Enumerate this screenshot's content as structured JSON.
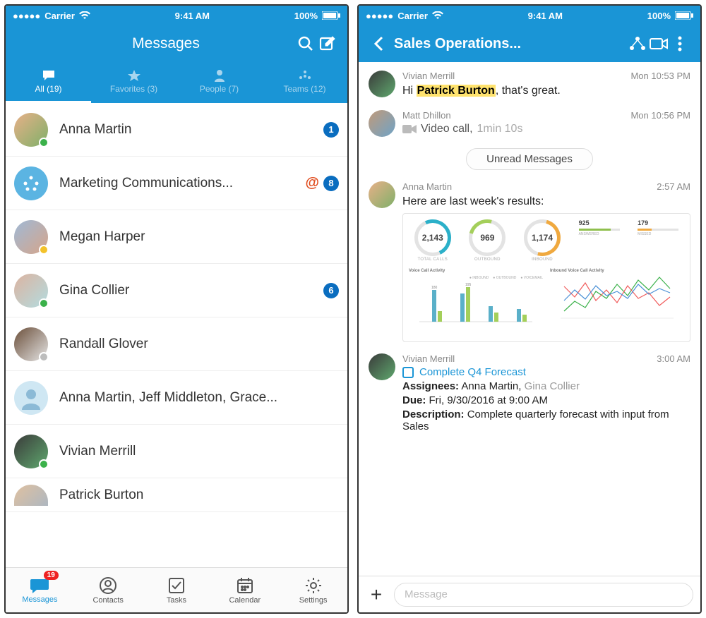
{
  "status": {
    "carrier": "Carrier",
    "time": "9:41 AM",
    "battery": "100%"
  },
  "left": {
    "title": "Messages",
    "tabs": [
      {
        "label": "All (19)",
        "icon": "chat"
      },
      {
        "label": "Favorites (3)",
        "icon": "star"
      },
      {
        "label": "People (7)",
        "icon": "person"
      },
      {
        "label": "Teams (12)",
        "icon": "team"
      }
    ],
    "rows": [
      {
        "name": "Anna Martin",
        "badge": "1",
        "presence": "#3bb14a"
      },
      {
        "name": "Marketing Communications...",
        "badge": "8",
        "at": true,
        "team": true
      },
      {
        "name": "Megan Harper",
        "presence": "#f3c22b"
      },
      {
        "name": "Gina Collier",
        "badge": "6",
        "presence": "#3bb14a"
      },
      {
        "name": "Randall Glover",
        "presence": "#bdbdbd"
      },
      {
        "name": "Anna Martin, Jeff Middleton, Grace...",
        "placeholder": true
      },
      {
        "name": "Vivian Merrill",
        "presence": "#3bb14a"
      },
      {
        "name": "Patrick Burton"
      }
    ],
    "bottom": [
      {
        "label": "Messages",
        "badge": "19"
      },
      {
        "label": "Contacts"
      },
      {
        "label": "Tasks"
      },
      {
        "label": "Calendar"
      },
      {
        "label": "Settings"
      }
    ]
  },
  "right": {
    "title": "Sales Operations...",
    "messages": [
      {
        "sender": "Vivian Merrill",
        "time": "Mon 10:53 PM",
        "text_pre": "Hi ",
        "mention": "Patrick Burton",
        "text_post": ", that's great."
      },
      {
        "sender": "Matt Dhillon",
        "time": "Mon 10:56 PM",
        "video": "Video call,",
        "duration": "1min 10s"
      }
    ],
    "unread_label": "Unread Messages",
    "anna": {
      "sender": "Anna Martin",
      "time": "2:57 AM",
      "text": "Here are last week's results:"
    },
    "vivian2": {
      "sender": "Vivian Merrill",
      "time": "3:00 AM",
      "task_title": "Complete Q4 Forecast",
      "assignees_label": "Assignees:",
      "assignees_main": "Anna Martin,",
      "assignees_rest": "Gina Collier",
      "due_label": "Due:",
      "due_value": "Fri, 9/30/2016 at 9:00 AM",
      "desc_label": "Description:",
      "desc_value": "Complete quarterly forecast with input from Sales"
    },
    "input_placeholder": "Message"
  },
  "chart_data": {
    "gauges": [
      {
        "value": "2,143",
        "label": "TOTAL CALLS",
        "color": "#2bb0c9"
      },
      {
        "value": "969",
        "label": "OUTBOUND",
        "color": "#a4cf5a"
      },
      {
        "value": "1,174",
        "label": "INBOUND",
        "color": "#f0a93f"
      }
    ],
    "minis": [
      {
        "value": "925",
        "label": "ANSWERED",
        "pct": 78
      },
      {
        "value": "179",
        "label": "MISSED",
        "pct": 35
      }
    ],
    "subcharts": [
      {
        "title": "Voice Call Activity",
        "type": "bar",
        "legend": [
          "INBOUND",
          "OUTBOUND",
          "VOICEMAIL"
        ],
        "categories": [
          "",
          "",
          "",
          ""
        ],
        "series": [
          {
            "name": "inbound",
            "values": [
              180,
              140,
              90,
              70
            ]
          },
          {
            "name": "outbound",
            "values": [
              60,
              195,
              50,
              40
            ]
          }
        ],
        "ylim": [
          0,
          200
        ]
      },
      {
        "title": "Inbound Voice Call Activity",
        "type": "line",
        "series": [
          {
            "name": "a",
            "color": "#3bb14a",
            "values": [
              20,
              45,
              30,
              70,
              55,
              90,
              65,
              110,
              85,
              130
            ]
          },
          {
            "name": "b",
            "color": "#f05b5b",
            "values": [
              90,
              60,
              100,
              55,
              80,
              50,
              95,
              60,
              75,
              40
            ]
          },
          {
            "name": "c",
            "color": "#4a90d6",
            "values": [
              50,
              80,
              55,
              95,
              70,
              85,
              60,
              100,
              75,
              90
            ]
          }
        ],
        "ylim": [
          0,
          140
        ]
      }
    ]
  }
}
